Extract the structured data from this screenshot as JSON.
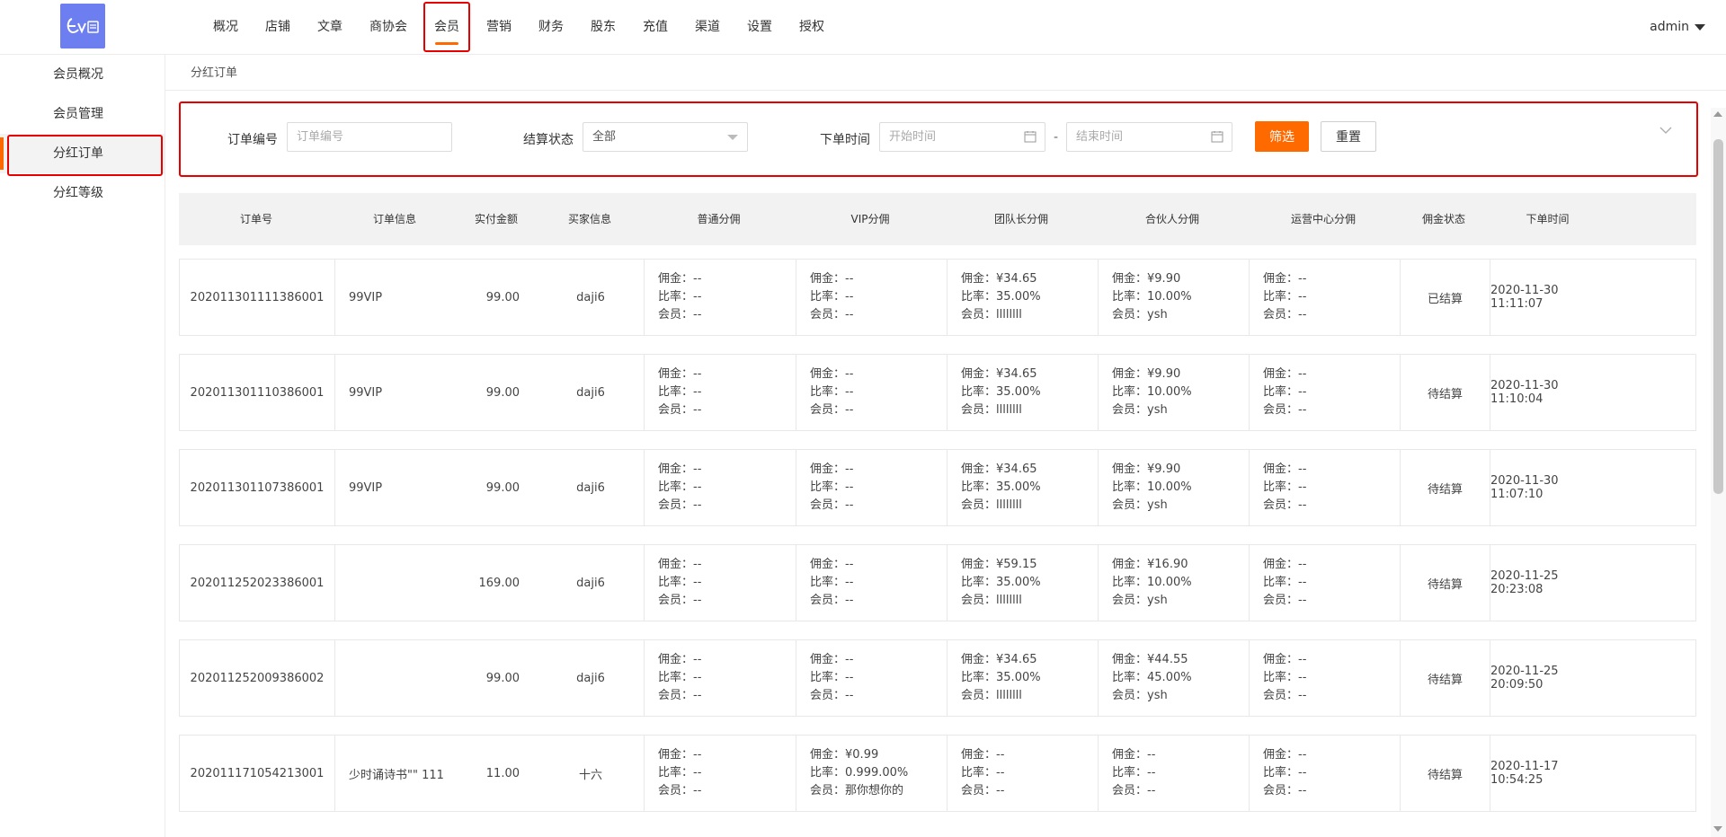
{
  "brand": {
    "logo_text": "ev赞",
    "logo_color": "#6c7ef0"
  },
  "nav": {
    "items": [
      {
        "label": "概况"
      },
      {
        "label": "店铺"
      },
      {
        "label": "文章"
      },
      {
        "label": "商协会"
      },
      {
        "label": "会员",
        "active": true
      },
      {
        "label": "营销"
      },
      {
        "label": "财务"
      },
      {
        "label": "股东"
      },
      {
        "label": "充值"
      },
      {
        "label": "渠道"
      },
      {
        "label": "设置"
      },
      {
        "label": "授权"
      }
    ]
  },
  "user": {
    "name": "admin"
  },
  "sidebar": {
    "items": [
      {
        "label": "会员概况"
      },
      {
        "label": "会员管理"
      },
      {
        "label": "分红订单",
        "active": true
      },
      {
        "label": "分红等级"
      }
    ]
  },
  "breadcrumb": {
    "label": "分红订单"
  },
  "filter": {
    "order_no_label": "订单编号",
    "order_no_placeholder": "订单编号",
    "status_label": "结算状态",
    "status_value": "全部",
    "time_label": "下单时间",
    "start_placeholder": "开始时间",
    "end_placeholder": "结束时间",
    "dash": "-",
    "filter_button": "筛选",
    "reset_button": "重置"
  },
  "table": {
    "headers": [
      "订单号",
      "订单信息",
      "实付金额",
      "买家信息",
      "普通分佣",
      "VIP分佣",
      "团队长分佣",
      "合伙人分佣",
      "运营中心分佣",
      "佣金状态",
      "下单时间"
    ],
    "commission_labels": {
      "amount": "佣金：",
      "rate": "比率：",
      "member": "会员："
    },
    "rows": [
      {
        "order_no": "202011301111386001",
        "info": "99VIP",
        "paid": "99.00",
        "buyer": "daji6",
        "normal": {
          "amount": "--",
          "rate": "--",
          "member": "--"
        },
        "vip": {
          "amount": "--",
          "rate": "--",
          "member": "--"
        },
        "team": {
          "amount": "¥34.65",
          "rate": "35.00%",
          "member": "llllllll"
        },
        "partner": {
          "amount": "¥9.90",
          "rate": "10.00%",
          "member": "ysh"
        },
        "ops": {
          "amount": "--",
          "rate": "--",
          "member": "--"
        },
        "status": "已结算",
        "time": "2020-11-30 11:11:07"
      },
      {
        "order_no": "202011301110386001",
        "info": "99VIP",
        "paid": "99.00",
        "buyer": "daji6",
        "normal": {
          "amount": "--",
          "rate": "--",
          "member": "--"
        },
        "vip": {
          "amount": "--",
          "rate": "--",
          "member": "--"
        },
        "team": {
          "amount": "¥34.65",
          "rate": "35.00%",
          "member": "llllllll"
        },
        "partner": {
          "amount": "¥9.90",
          "rate": "10.00%",
          "member": "ysh"
        },
        "ops": {
          "amount": "--",
          "rate": "--",
          "member": "--"
        },
        "status": "待结算",
        "time": "2020-11-30 11:10:04"
      },
      {
        "order_no": "202011301107386001",
        "info": "99VIP",
        "paid": "99.00",
        "buyer": "daji6",
        "normal": {
          "amount": "--",
          "rate": "--",
          "member": "--"
        },
        "vip": {
          "amount": "--",
          "rate": "--",
          "member": "--"
        },
        "team": {
          "amount": "¥34.65",
          "rate": "35.00%",
          "member": "llllllll"
        },
        "partner": {
          "amount": "¥9.90",
          "rate": "10.00%",
          "member": "ysh"
        },
        "ops": {
          "amount": "--",
          "rate": "--",
          "member": "--"
        },
        "status": "待结算",
        "time": "2020-11-30 11:07:10"
      },
      {
        "order_no": "202011252023386001",
        "info": "",
        "paid": "169.00",
        "buyer": "daji6",
        "normal": {
          "amount": "--",
          "rate": "--",
          "member": "--"
        },
        "vip": {
          "amount": "--",
          "rate": "--",
          "member": "--"
        },
        "team": {
          "amount": "¥59.15",
          "rate": "35.00%",
          "member": "llllllll"
        },
        "partner": {
          "amount": "¥16.90",
          "rate": "10.00%",
          "member": "ysh"
        },
        "ops": {
          "amount": "--",
          "rate": "--",
          "member": "--"
        },
        "status": "待结算",
        "time": "2020-11-25 20:23:08"
      },
      {
        "order_no": "202011252009386002",
        "info": "",
        "paid": "99.00",
        "buyer": "daji6",
        "normal": {
          "amount": "--",
          "rate": "--",
          "member": "--"
        },
        "vip": {
          "amount": "--",
          "rate": "--",
          "member": "--"
        },
        "team": {
          "amount": "¥34.65",
          "rate": "35.00%",
          "member": "llllllll"
        },
        "partner": {
          "amount": "¥44.55",
          "rate": "45.00%",
          "member": "ysh"
        },
        "ops": {
          "amount": "--",
          "rate": "--",
          "member": "--"
        },
        "status": "待结算",
        "time": "2020-11-25 20:09:50"
      },
      {
        "order_no": "202011171054213001",
        "info": "少时诵诗书\"\" 111",
        "paid": "11.00",
        "buyer": "十六",
        "normal": {
          "amount": "--",
          "rate": "--",
          "member": "--"
        },
        "vip": {
          "amount": "¥0.99",
          "rate": "0.999.00%",
          "member": "那你想你的"
        },
        "team": {
          "amount": "--",
          "rate": "--",
          "member": "--"
        },
        "partner": {
          "amount": "--",
          "rate": "--",
          "member": "--"
        },
        "ops": {
          "amount": "--",
          "rate": "--",
          "member": "--"
        },
        "status": "待结算",
        "time": "2020-11-17 10:54:25"
      }
    ]
  },
  "colors": {
    "accent": "#ff6a00",
    "highlight_border": "#e60000",
    "header_bg": "#f2f2f2"
  }
}
